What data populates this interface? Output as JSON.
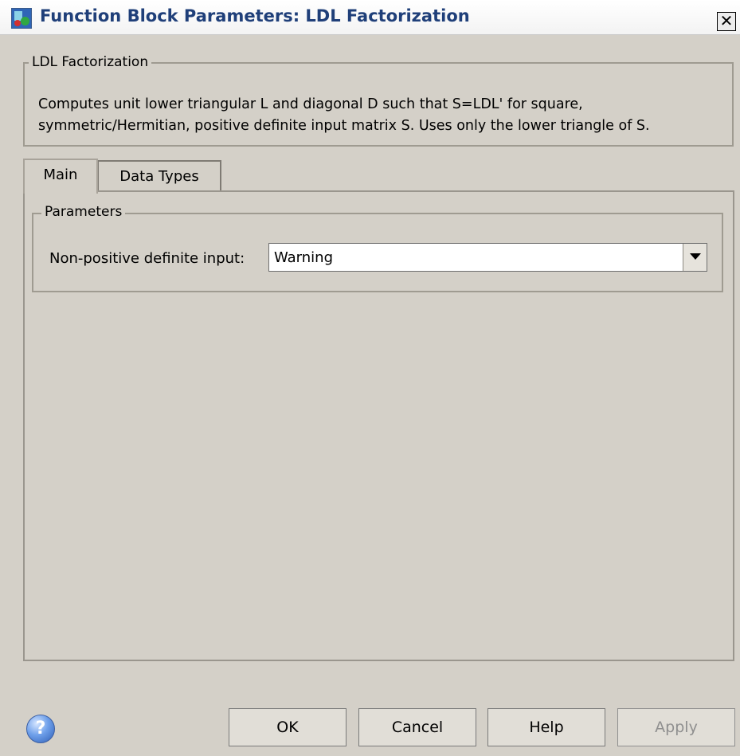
{
  "window": {
    "title": "Function Block Parameters: LDL Factorization",
    "close_glyph": "✕"
  },
  "block": {
    "group_label": "LDL Factorization",
    "description_line1": "Computes unit lower triangular L and diagonal D such that S=LDL' for square,",
    "description_line2": "symmetric/Hermitian, positive definite input matrix S. Uses only the lower triangle of S."
  },
  "tabs": [
    {
      "label": "Main",
      "active": true
    },
    {
      "label": "Data Types",
      "active": false
    }
  ],
  "parameters": {
    "group_label": "Parameters",
    "non_positive_label": "Non-positive definite input:",
    "non_positive_value": "Warning"
  },
  "footer": {
    "help_icon": "help-icon",
    "help_glyph": "?",
    "ok_label": "OK",
    "cancel_label": "Cancel",
    "help_label": "Help",
    "apply_label": "Apply",
    "apply_enabled": false
  },
  "colors": {
    "dialog_bg": "#d4d0c8",
    "title_text": "#1f3f79",
    "disabled_text": "#8f8f8f"
  }
}
